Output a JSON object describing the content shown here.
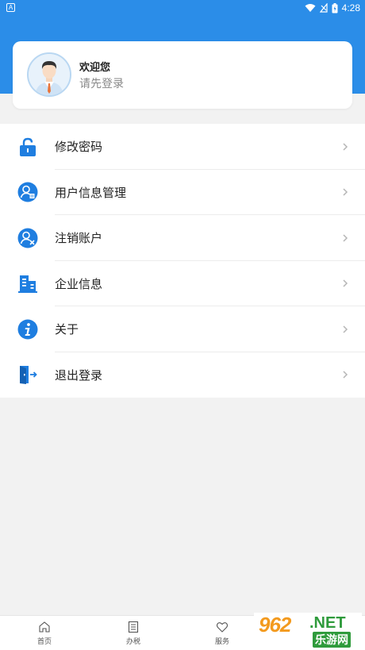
{
  "status_bar": {
    "left_badge": "A",
    "time": "4:28",
    "icons": [
      "wifi-icon",
      "no-signal-icon",
      "battery-charging-icon"
    ]
  },
  "user": {
    "greeting": "欢迎您",
    "login_tip": "请先登录",
    "avatar_icon": "user-avatar-icon"
  },
  "menu": {
    "items": [
      {
        "label": "修改密码",
        "icon": "lock-icon"
      },
      {
        "label": "用户信息管理",
        "icon": "user-info-icon"
      },
      {
        "label": "注销账户",
        "icon": "user-cancel-icon"
      },
      {
        "label": "企业信息",
        "icon": "building-icon"
      },
      {
        "label": "关于",
        "icon": "info-icon"
      },
      {
        "label": "退出登录",
        "icon": "logout-door-icon"
      }
    ]
  },
  "tabbar": {
    "tabs": [
      {
        "label": "首页",
        "icon": "home-icon"
      },
      {
        "label": "办税",
        "icon": "document-list-icon"
      },
      {
        "label": "服务",
        "icon": "heart-icon"
      }
    ]
  },
  "watermark": {
    "number": "962",
    "net": ".NET",
    "name": "乐游网"
  },
  "colors": {
    "primary": "#2b8de8",
    "icon_blue": "#1f7ee0",
    "background": "#f2f2f2"
  }
}
